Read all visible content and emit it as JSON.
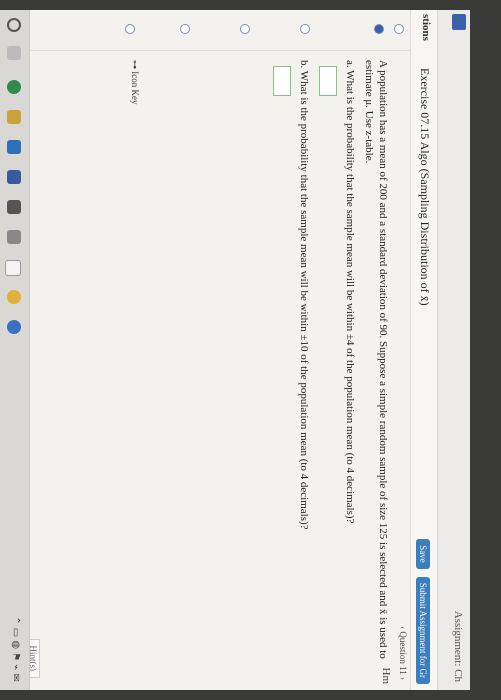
{
  "header": {
    "assignment_label": "Assignment: Ch",
    "questions_tab": "stions",
    "exercise_title": "Exercise 07.15 Algo (Sampling Distribution of x̄)",
    "save_label": "Save",
    "submit_label": "Submit Assignment for Gr",
    "question_nav": "‹ Question 11 ›",
    "help_me": "Hm"
  },
  "problem": {
    "intro": "A population has a mean of 200 and a standard deviation of 90. Suppose a simple random sample of size 125 is selected and x̄ is used to estimate μ. Use z-table.",
    "part_a": "a. What is the probability that the sample mean will be within ±4 of the population mean (to 4 decimals)?",
    "part_b": "b. What is the probability that the sample mean will be within ±10 of the population mean (to 4 decimals)?"
  },
  "footer": {
    "icon_key": "Icon Key",
    "hint": "Hint(s)"
  },
  "taskbar": {
    "tray_text": "⌃ ▭ ◍ ⚑ ⌁ ✉"
  },
  "colors": {
    "accent": "#3d5ea8",
    "button": "#3c7dbd",
    "answer_border": "#8ac08a"
  }
}
